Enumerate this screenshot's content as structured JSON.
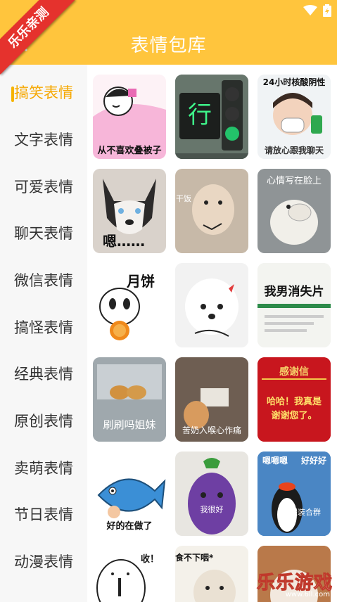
{
  "header": {
    "title": "表情包库"
  },
  "badge": {
    "label": "乐乐亲测"
  },
  "sidebar": {
    "items": [
      {
        "label": "搞笑表情"
      },
      {
        "label": "文字表情"
      },
      {
        "label": "可爱表情"
      },
      {
        "label": "聊天表情"
      },
      {
        "label": "微信表情"
      },
      {
        "label": "搞怪表情"
      },
      {
        "label": "经典表情"
      },
      {
        "label": "原创表情"
      },
      {
        "label": "卖萌表情"
      },
      {
        "label": "节日表情"
      },
      {
        "label": "动漫表情"
      }
    ],
    "active": "搞笑表情"
  },
  "stickers": [
    {
      "caption": "从不喜欢叠被子"
    },
    {
      "caption": "行"
    },
    {
      "caption_top": "24小时核酸阴性",
      "caption": "请放心跟我聊天"
    },
    {
      "caption": "嗯……"
    },
    {
      "caption": "干饭"
    },
    {
      "caption": "心情写在脸上"
    },
    {
      "caption": "月饼"
    },
    {
      "caption": ""
    },
    {
      "caption": "我男消失片"
    },
    {
      "caption": "刷刷吗姐妹"
    },
    {
      "caption": "苦奶入喉心作痛"
    },
    {
      "caption_top": "感谢信",
      "caption": "哈哈！我真是谢谢您了。"
    },
    {
      "caption": "好的在做了"
    },
    {
      "caption": "我很好"
    },
    {
      "caption_top": "嗯嗯嗯",
      "caption_right": "好好好",
      "caption": "假装合群"
    },
    {
      "caption": "收！"
    },
    {
      "caption": "食不下咽*"
    },
    {
      "caption": ""
    }
  ],
  "watermark": {
    "text": "乐乐游戏",
    "url": "www.6ll.com"
  },
  "colors": {
    "appbar": "#ffc53d",
    "active": "#f6a800",
    "banner": "#e5322d"
  }
}
